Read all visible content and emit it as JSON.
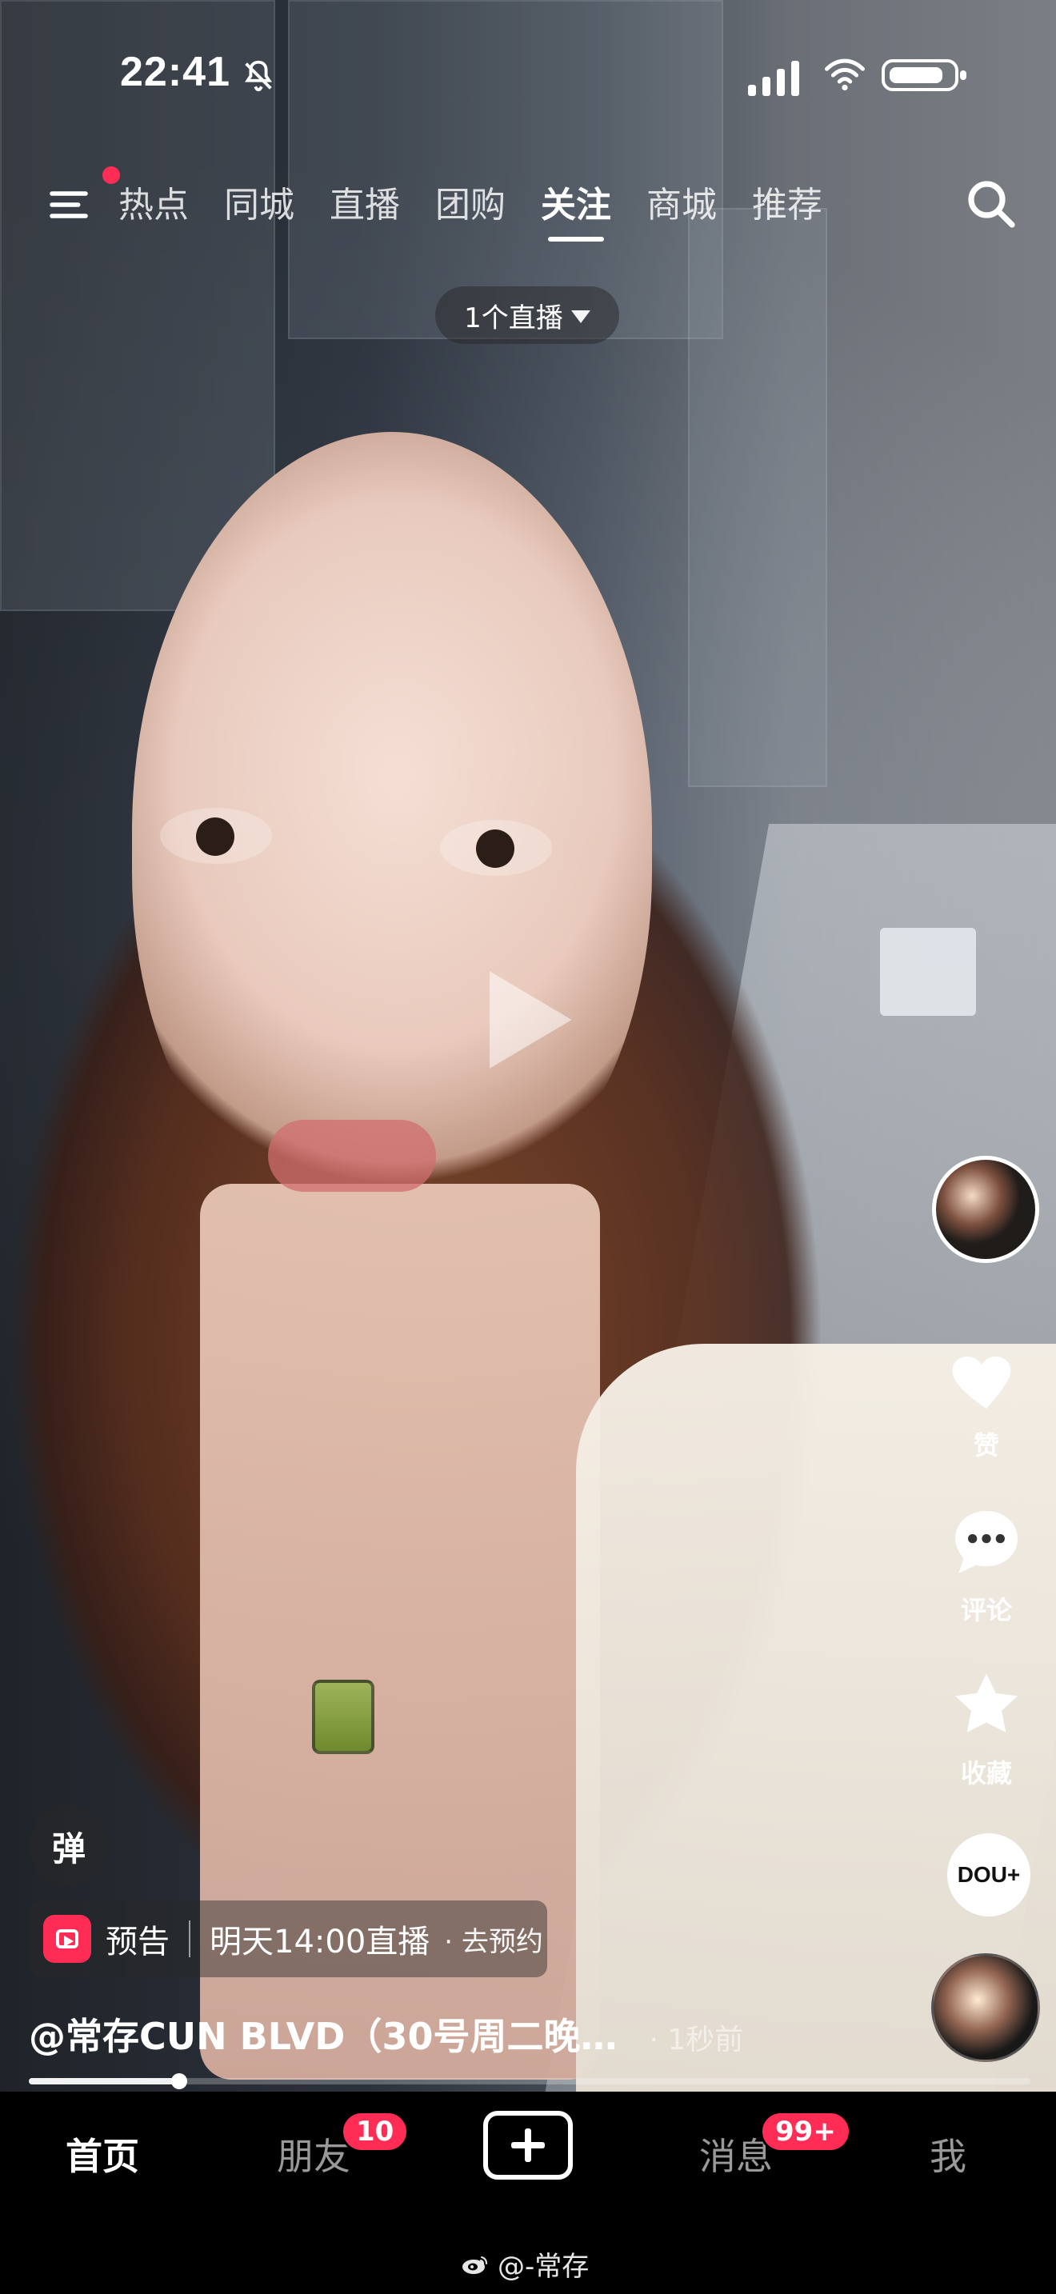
{
  "status_bar": {
    "time": "22:41",
    "icons": [
      "silent-bell-icon",
      "signal-icon",
      "wifi-icon",
      "battery-icon"
    ]
  },
  "top_nav": {
    "tabs": [
      "热点",
      "同城",
      "直播",
      "团购",
      "关注",
      "商城",
      "推荐"
    ],
    "active_tab": "关注",
    "menu_has_notification": true
  },
  "live_pill": {
    "label": "1个直播"
  },
  "right_rail": {
    "like_label": "赞",
    "comment_label": "评论",
    "favorite_label": "收藏",
    "music_badge_text": "DOU+"
  },
  "bottom_overlay": {
    "danmu_label": "弹",
    "preview": {
      "tag": "预告",
      "schedule": "明天14:00直播",
      "action": "· 去预约"
    },
    "caption": "@常存CUN BLVD（30号周二晚…",
    "time_ago": "· 1秒前",
    "progress_fraction": 0.15
  },
  "bottom_nav": {
    "items": [
      {
        "label": "首页"
      },
      {
        "label": "朋友"
      },
      {
        "label": "消息"
      },
      {
        "label": "我"
      }
    ],
    "active": "首页",
    "friends_badge": "10",
    "messages_badge": "99+"
  },
  "watermark": {
    "text": "@-常存"
  },
  "colors": {
    "accent": "#ff2d55",
    "nav_bg": "#000000",
    "text": "#ffffff"
  }
}
